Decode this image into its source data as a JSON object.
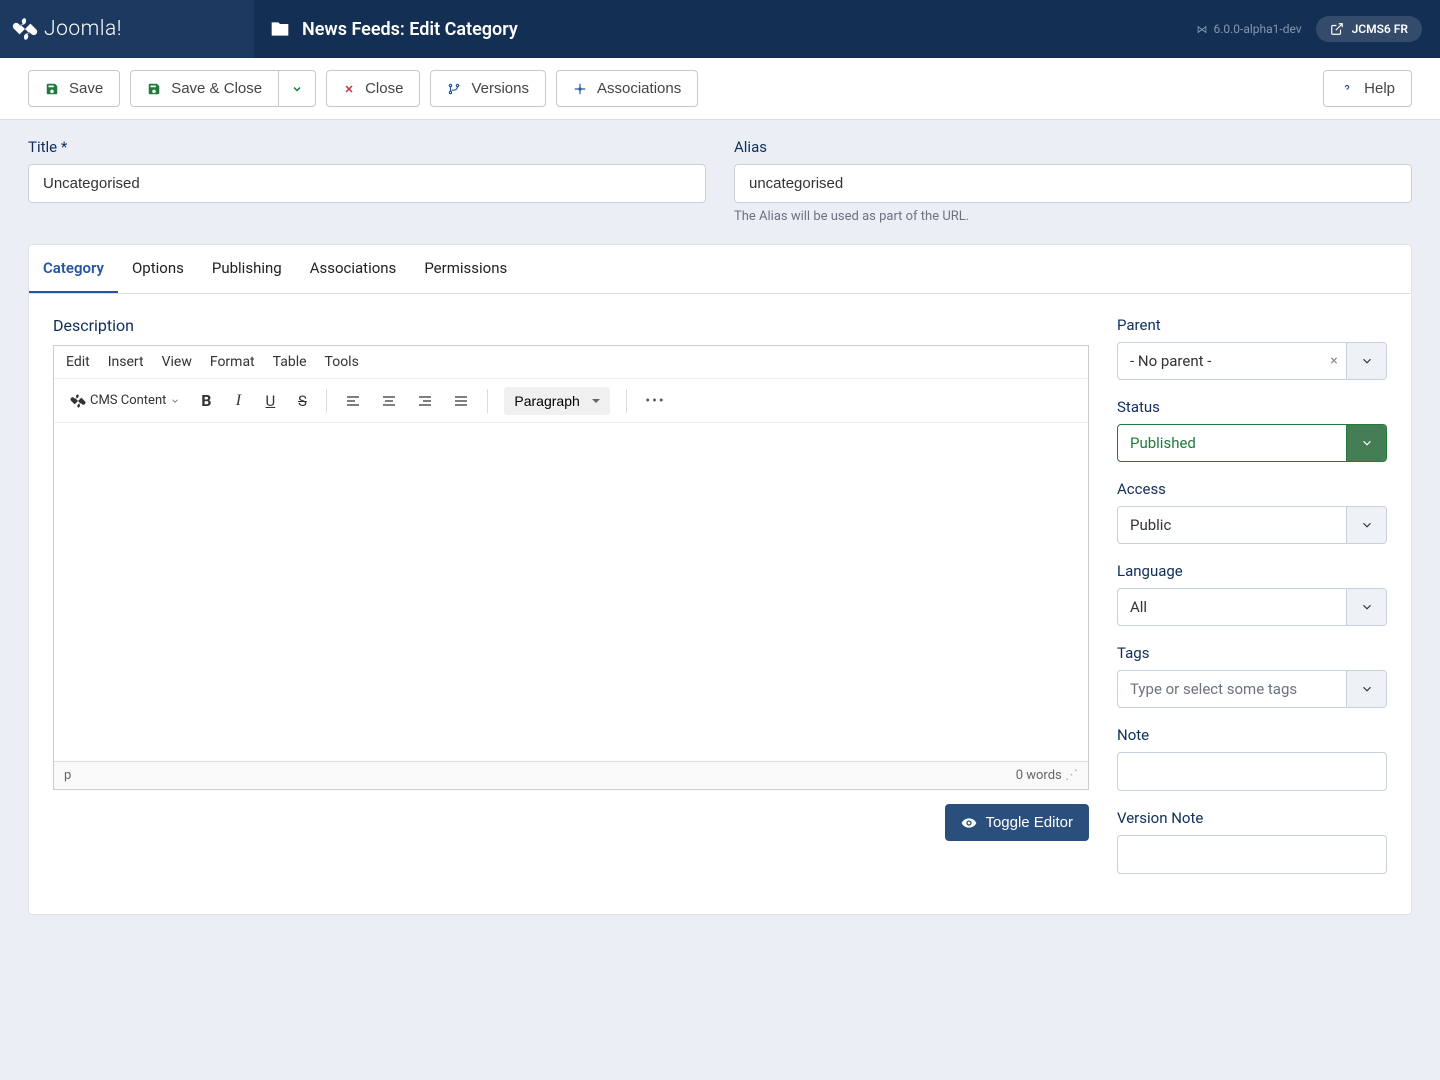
{
  "header": {
    "brand": "Joomla!",
    "page_title": "News Feeds: Edit Category",
    "version": "6.0.0-alpha1-dev",
    "user_chip": "JCMS6 FR"
  },
  "toolbar": {
    "save": "Save",
    "save_close": "Save & Close",
    "close": "Close",
    "versions": "Versions",
    "associations": "Associations",
    "help": "Help"
  },
  "form": {
    "title_label": "Title *",
    "title_value": "Uncategorised",
    "alias_label": "Alias",
    "alias_value": "uncategorised",
    "alias_help": "The Alias will be used as part of the URL."
  },
  "tabs": [
    "Category",
    "Options",
    "Publishing",
    "Associations",
    "Permissions"
  ],
  "editor": {
    "description_label": "Description",
    "menubar": [
      "Edit",
      "Insert",
      "View",
      "Format",
      "Table",
      "Tools"
    ],
    "cms_content": "CMS Content",
    "format_select": "Paragraph",
    "status_path": "p",
    "word_count": "0 words",
    "toggle_label": "Toggle Editor"
  },
  "sidebar": {
    "parent": {
      "label": "Parent",
      "value": "- No parent -"
    },
    "status": {
      "label": "Status",
      "value": "Published"
    },
    "access": {
      "label": "Access",
      "value": "Public"
    },
    "language": {
      "label": "Language",
      "value": "All"
    },
    "tags": {
      "label": "Tags",
      "placeholder": "Type or select some tags"
    },
    "note": {
      "label": "Note"
    },
    "version_note": {
      "label": "Version Note"
    }
  }
}
